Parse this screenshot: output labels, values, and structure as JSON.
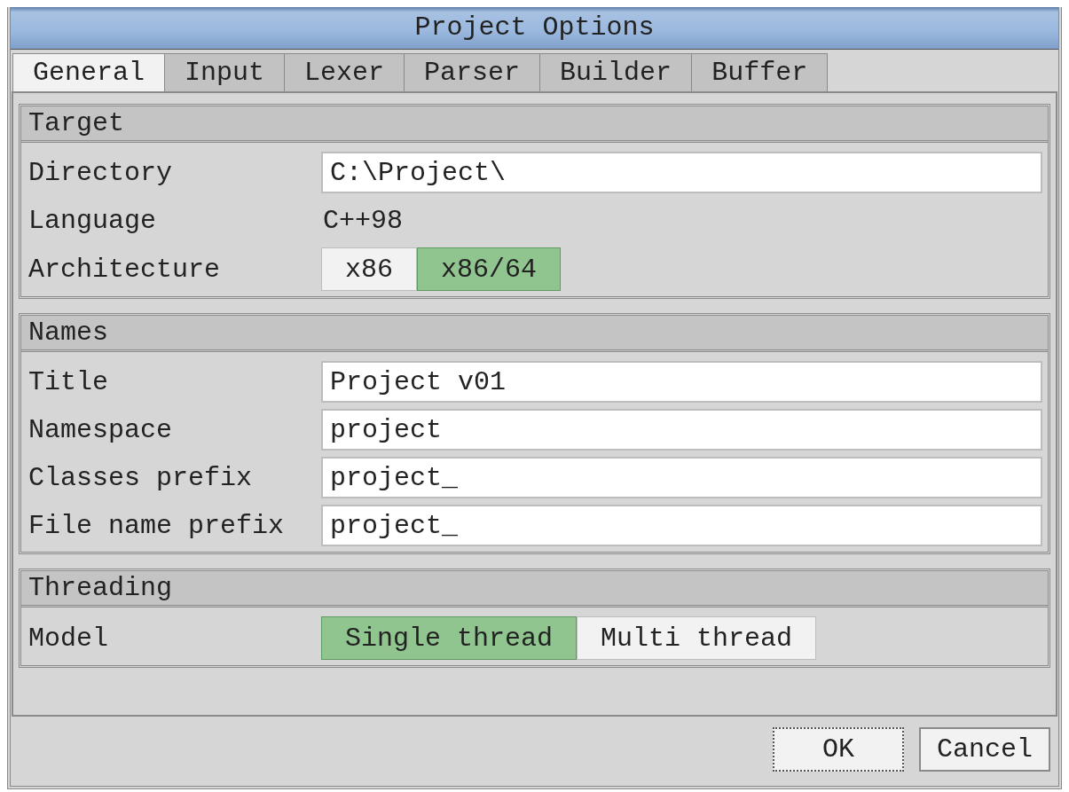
{
  "window": {
    "title": "Project Options"
  },
  "tabs": [
    {
      "label": "General",
      "selected": true
    },
    {
      "label": "Input",
      "selected": false
    },
    {
      "label": "Lexer",
      "selected": false
    },
    {
      "label": "Parser",
      "selected": false
    },
    {
      "label": "Builder",
      "selected": false
    },
    {
      "label": "Buffer",
      "selected": false
    }
  ],
  "groups": [
    {
      "title": "Target",
      "rows": [
        {
          "kind": "field",
          "label": "Directory",
          "value": "C:\\Project\\"
        },
        {
          "kind": "text",
          "label": "Language",
          "value": "C++98"
        },
        {
          "kind": "choice",
          "label": "Architecture",
          "options": [
            {
              "label": "x86",
              "selected": false
            },
            {
              "label": "x86/64",
              "selected": true
            }
          ]
        }
      ]
    },
    {
      "title": "Names",
      "rows": [
        {
          "kind": "field",
          "label": "Title",
          "value": "Project v01"
        },
        {
          "kind": "field",
          "label": "Namespace",
          "value": "project"
        },
        {
          "kind": "field",
          "label": "Classes prefix",
          "value": "project_"
        },
        {
          "kind": "field",
          "label": "File name prefix",
          "value": "project_"
        }
      ]
    },
    {
      "title": "Threading",
      "rows": [
        {
          "kind": "choice",
          "label": "Model",
          "options": [
            {
              "label": "Single thread",
              "selected": true
            },
            {
              "label": "Multi thread",
              "selected": false
            }
          ]
        }
      ]
    }
  ],
  "buttons": [
    {
      "label": "OK",
      "focused": true
    },
    {
      "label": "Cancel",
      "focused": false
    }
  ]
}
